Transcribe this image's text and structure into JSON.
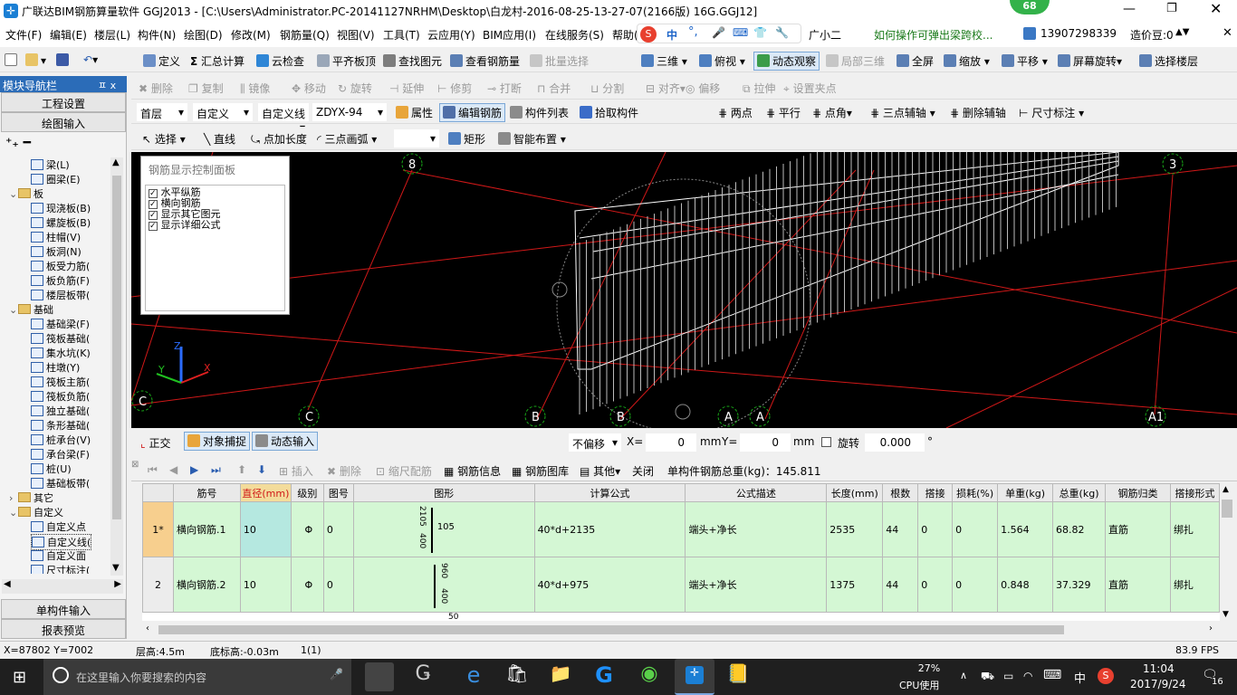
{
  "title_bar": {
    "title": "广联达BIM钢筋算量软件 GGJ2013 - [C:\\Users\\Administrator.PC-20141127NRHM\\Desktop\\白龙村-2016-08-25-13-27-07(2166版) 16G.GGJ12]",
    "badge": "68"
  },
  "menu": {
    "items": [
      "文件(F)",
      "编辑(E)",
      "楼层(L)",
      "构件(N)",
      "绘图(D)",
      "修改(M)",
      "钢筋量(Q)",
      "视图(V)",
      "工具(T)",
      "云应用(Y)",
      "BIM应用(I)",
      "在线服务(S)",
      "帮助("
    ],
    "ime_zh": "中",
    "assistant": "广小二",
    "question": "如何操作可弹出梁跨校...",
    "phone": "13907298339",
    "price": "造价豆:0"
  },
  "toolbar1": {
    "define": "定义",
    "summary": "汇总计算",
    "cloud_check": "云检查",
    "flush_top": "平齐板顶",
    "find": "查找图元",
    "view_rebar": "查看钢筋量",
    "batch_select": "批量选择",
    "three_d": "三维",
    "top_view": "俯视",
    "dynamic": "动态观察",
    "local_3d": "局部三维",
    "fullscreen": "全屏",
    "zoom": "缩放",
    "pan": "平移",
    "rotate_screen": "屏幕旋转",
    "select_floor": "选择楼层"
  },
  "toolbar2": {
    "delete": "删除",
    "copy": "复制",
    "mirror": "镜像",
    "move": "移动",
    "rotate": "旋转",
    "extend": "延伸",
    "trim": "修剪",
    "break": "打断",
    "merge": "合并",
    "split": "分割",
    "align": "对齐",
    "offset": "偏移",
    "stretch": "拉伸",
    "set_grip": "设置夹点"
  },
  "toolbar3": {
    "floor": "首层",
    "category": "自定义",
    "sub_type": "自定义线",
    "element": "ZDYX-94",
    "properties": "属性",
    "edit_rebar": "编辑钢筋",
    "element_list": "构件列表",
    "pick": "拾取构件",
    "two_points": "两点",
    "parallel": "平行",
    "point_angle": "点角",
    "three_point_aux": "三点辅轴",
    "delete_aux": "删除辅轴",
    "dimension": "尺寸标注"
  },
  "toolbar4": {
    "select": "选择",
    "line": "直线",
    "add_length": "点加长度",
    "three_point_arc": "三点画弧",
    "rect": "矩形",
    "smart_layout": "智能布置"
  },
  "nav": {
    "header": "模块导航栏",
    "pin": "ㅍ x",
    "project_settings": "工程设置",
    "drawing_input": "绘图输入",
    "tree": [
      {
        "label": "梁(L)",
        "level": 2,
        "kind": "item"
      },
      {
        "label": "圈梁(E)",
        "level": 2,
        "kind": "item"
      },
      {
        "label": "板",
        "level": 1,
        "kind": "folder",
        "exp": "⌄"
      },
      {
        "label": "现浇板(B)",
        "level": 2,
        "kind": "item"
      },
      {
        "label": "螺旋板(B)",
        "level": 2,
        "kind": "item"
      },
      {
        "label": "柱帽(V)",
        "level": 2,
        "kind": "item"
      },
      {
        "label": "板洞(N)",
        "level": 2,
        "kind": "item"
      },
      {
        "label": "板受力筋(",
        "level": 2,
        "kind": "item"
      },
      {
        "label": "板负筋(F)",
        "level": 2,
        "kind": "item"
      },
      {
        "label": "楼层板带(",
        "level": 2,
        "kind": "item"
      },
      {
        "label": "基础",
        "level": 1,
        "kind": "folder",
        "exp": "⌄"
      },
      {
        "label": "基础梁(F)",
        "level": 2,
        "kind": "item"
      },
      {
        "label": "筏板基础(",
        "level": 2,
        "kind": "item"
      },
      {
        "label": "集水坑(K)",
        "level": 2,
        "kind": "item"
      },
      {
        "label": "柱墩(Y)",
        "level": 2,
        "kind": "item"
      },
      {
        "label": "筏板主筋(",
        "level": 2,
        "kind": "item"
      },
      {
        "label": "筏板负筋(",
        "level": 2,
        "kind": "item"
      },
      {
        "label": "独立基础(",
        "level": 2,
        "kind": "item"
      },
      {
        "label": "条形基础(",
        "level": 2,
        "kind": "item"
      },
      {
        "label": "桩承台(V)",
        "level": 2,
        "kind": "item"
      },
      {
        "label": "承台梁(F)",
        "level": 2,
        "kind": "item"
      },
      {
        "label": "桩(U)",
        "level": 2,
        "kind": "item"
      },
      {
        "label": "基础板带(",
        "level": 2,
        "kind": "item"
      },
      {
        "label": "其它",
        "level": 1,
        "kind": "folder",
        "exp": "›"
      },
      {
        "label": "自定义",
        "level": 1,
        "kind": "folder",
        "exp": "⌄"
      },
      {
        "label": "自定义点",
        "level": 2,
        "kind": "item"
      },
      {
        "label": "自定义线(",
        "level": 2,
        "kind": "item",
        "selected": true
      },
      {
        "label": "自定义面",
        "level": 2,
        "kind": "item"
      },
      {
        "label": "尺寸标注(",
        "level": 2,
        "kind": "item"
      }
    ],
    "single_input": "单构件输入",
    "report_preview": "报表预览"
  },
  "control_panel": {
    "title": "钢筋显示控制面板",
    "options": [
      "水平纵筋",
      "横向钢筋",
      "显示其它图元",
      "显示详细公式"
    ]
  },
  "viewport": {
    "axis_labels": [
      "8",
      "3",
      "C",
      "C",
      "B",
      "B",
      "A",
      "A",
      "A1"
    ],
    "axis_z": "Z",
    "axis_y": "Y",
    "axis_x": "X"
  },
  "snap_bar": {
    "ortho": "正交",
    "snap": "对象捕捉",
    "dyn_input": "动态输入",
    "offset_mode": "不偏移",
    "x_label": "X=",
    "x_value": "0",
    "mm1": "mm",
    "y_label": "Y=",
    "y_value": "0",
    "mm2": "mm",
    "rotate_label": "旋转",
    "rotate_value": "0.000",
    "deg": "°"
  },
  "grid_toolbar": {
    "insert": "插入",
    "delete": "删除",
    "scale_rebar": "缩尺配筋",
    "rebar_info": "钢筋信息",
    "rebar_lib": "钢筋图库",
    "other": "其他",
    "close": "关闭",
    "total_label": "单构件钢筋总重(kg)：145.811"
  },
  "grid": {
    "headers": [
      "筋号",
      "直径(mm)",
      "级别",
      "图号",
      "图形",
      "计算公式",
      "公式描述",
      "长度(mm)",
      "根数",
      "搭接",
      "损耗(%)",
      "单重(kg)",
      "总重(kg)",
      "钢筋归类",
      "搭接形式"
    ],
    "rows": [
      {
        "rownum": "1*",
        "name": "横向钢筋.1",
        "dia": "10",
        "grade": "Φ",
        "fig": "0",
        "shape_top": "2105",
        "shape_side": "400",
        "shape_mid": "105",
        "formula": "40*d+2135",
        "desc": "端头+净长",
        "length": "2535",
        "count": "44",
        "lap": "0",
        "loss": "0",
        "unit_w": "1.564",
        "total_w": "68.82",
        "cls": "直筋",
        "lap_type": "绑扎"
      },
      {
        "rownum": "2",
        "name": "横向钢筋.2",
        "dia": "10",
        "grade": "Φ",
        "fig": "0",
        "shape_top": "960",
        "shape_side": "400",
        "shape_mid": "",
        "formula": "40*d+975",
        "desc": "端头+净长",
        "length": "1375",
        "count": "44",
        "lap": "0",
        "loss": "0",
        "unit_w": "0.848",
        "total_w": "37.329",
        "cls": "直筋",
        "lap_type": "绑扎"
      }
    ],
    "row3_hint": "50"
  },
  "status": {
    "coords": "X=87802 Y=7002",
    "floor_h": "层高:4.5m",
    "bottom_h": "底标高:-0.03m",
    "count": "1(1)",
    "fps": "83.9 FPS"
  },
  "taskbar": {
    "search_placeholder": "在这里输入你要搜索的内容",
    "cpu_pct": "27%",
    "cpu_label": "CPU使用",
    "ime": "中",
    "time": "11:04",
    "date": "2017/9/24",
    "notif": "16"
  }
}
